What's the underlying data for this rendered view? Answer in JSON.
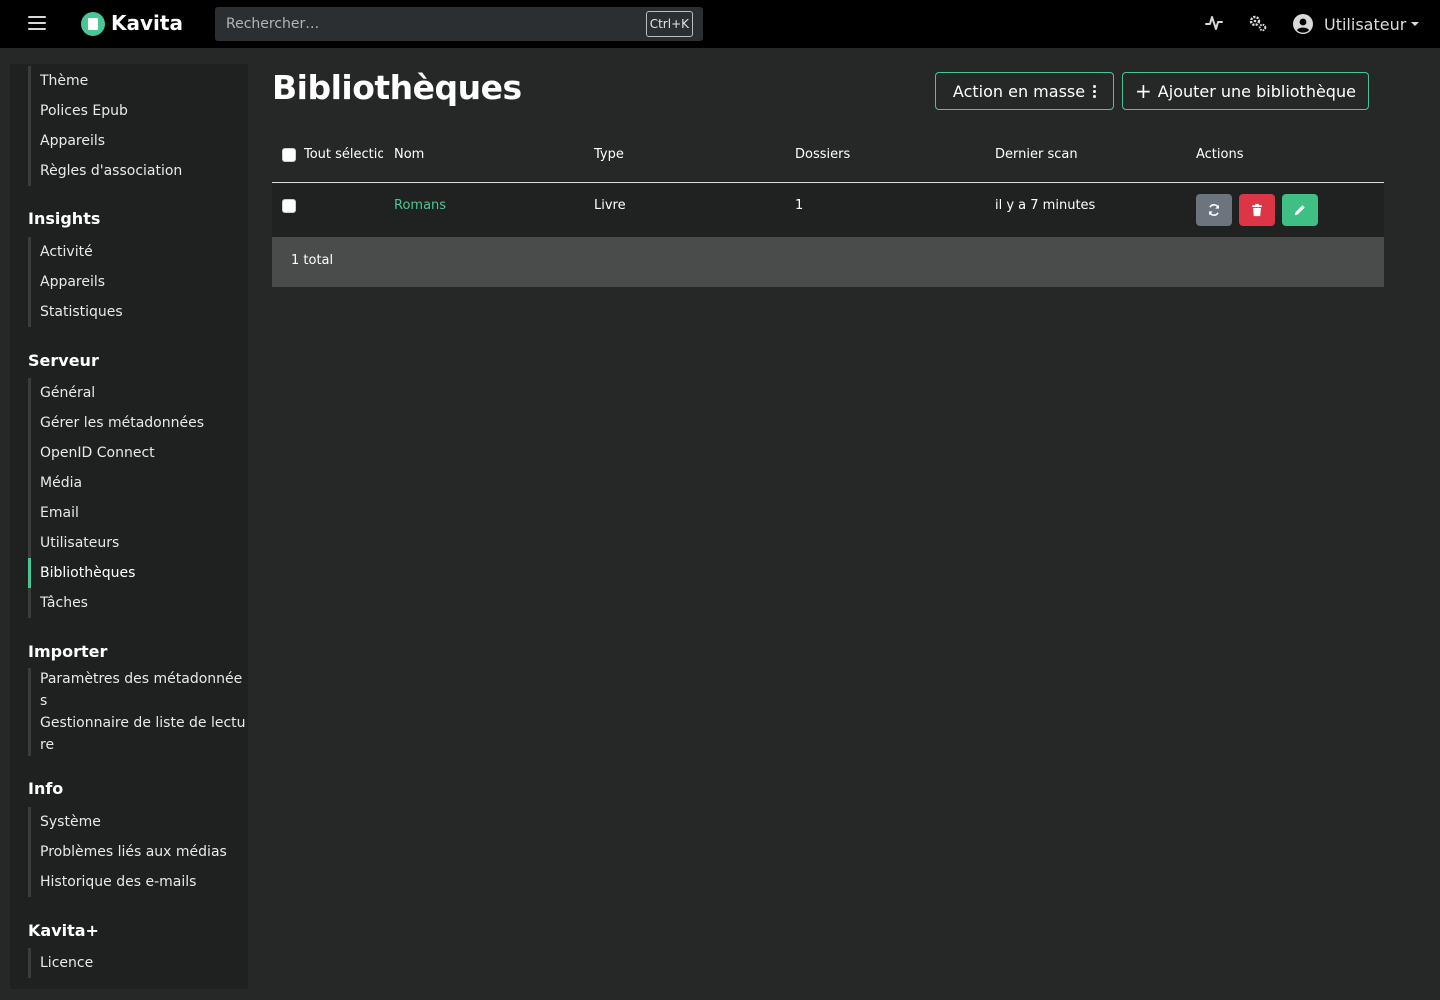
{
  "app": {
    "name": "Kavita"
  },
  "search": {
    "placeholder": "Rechercher…",
    "shortcut": "Ctrl+K"
  },
  "header": {
    "user_label": "Utilisateur"
  },
  "icons": {
    "menu": "hamburger-icon",
    "logo": "kavita-logo-icon",
    "activity": "pulse-icon",
    "settings": "cogs-icon",
    "user": "user-circle-icon"
  },
  "colors": {
    "accent": "#4ac694",
    "danger": "#dc3545",
    "secondary": "#6c757d"
  },
  "sidebar": {
    "top_items": [
      "Thème",
      "Polices Epub",
      "Appareils",
      "Règles d'association"
    ],
    "sections": [
      {
        "title": "Insights",
        "items": [
          "Activité",
          "Appareils",
          "Statistiques"
        ]
      },
      {
        "title": "Serveur",
        "items": [
          "Général",
          "Gérer les métadonnées",
          "OpenID Connect",
          "Média",
          "Email",
          "Utilisateurs",
          "Bibliothèques",
          "Tâches"
        ]
      },
      {
        "title": "Importer",
        "items": [
          "Paramètres des métadonnées",
          "Gestionnaire de liste de lecture"
        ]
      },
      {
        "title": "Info",
        "items": [
          "Système",
          "Problèmes liés aux médias",
          "Historique des e-mails"
        ]
      },
      {
        "title": "Kavita+",
        "items": [
          "Licence"
        ]
      }
    ],
    "active_item": "Bibliothèques"
  },
  "main": {
    "title": "Bibliothèques",
    "bulk_action_label": "Action en masse",
    "add_library_label": "Ajouter une bibliothèque",
    "table": {
      "columns": [
        "Tout sélectionner",
        "Nom",
        "Type",
        "Dossiers",
        "Dernier scan",
        "Actions"
      ],
      "rows": [
        {
          "name": "Romans",
          "type": "Livre",
          "folders": "1",
          "last_scan": "il y a 7 minutes"
        }
      ],
      "footer": "1 total"
    }
  }
}
